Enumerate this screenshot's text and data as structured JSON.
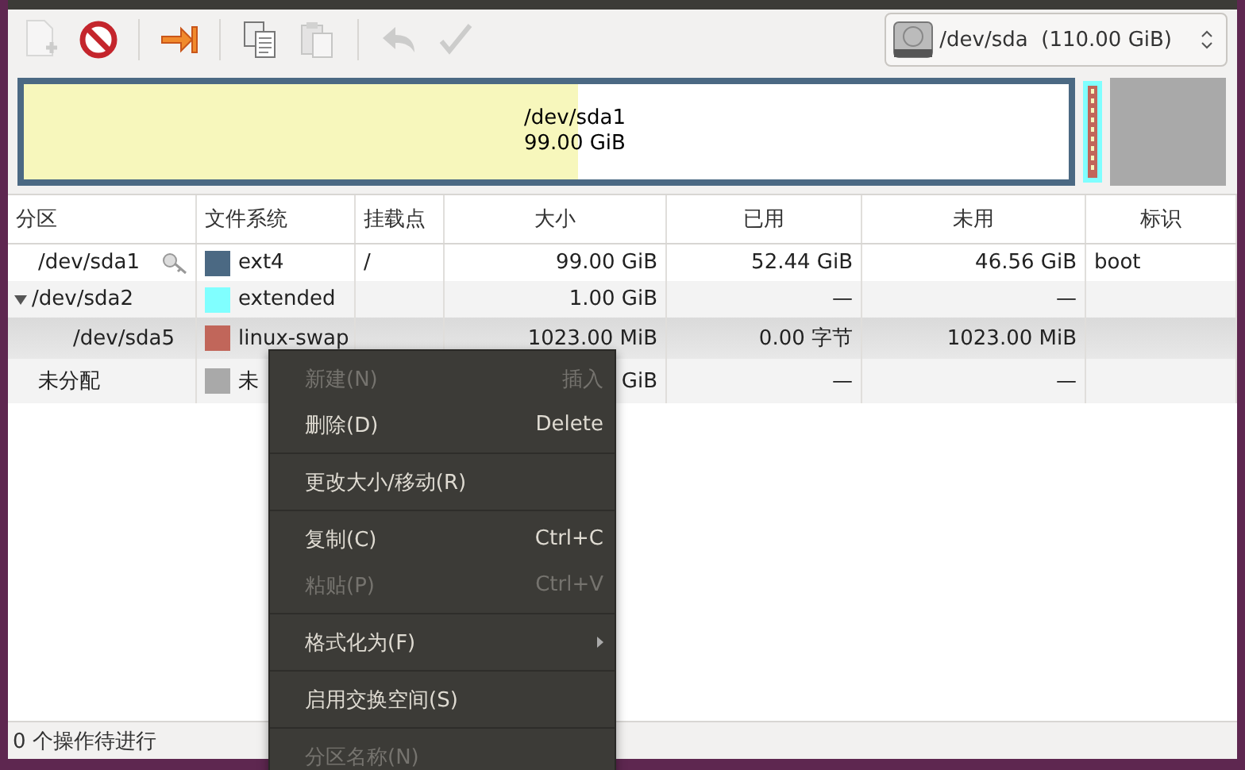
{
  "toolbar": [
    {
      "kind": "new",
      "disabled": true
    },
    {
      "kind": "delete",
      "disabled": false
    },
    {
      "kind": "sep"
    },
    {
      "kind": "resize",
      "disabled": false
    },
    {
      "kind": "sep"
    },
    {
      "kind": "copy",
      "disabled": false
    },
    {
      "kind": "paste",
      "disabled": true
    },
    {
      "kind": "sep"
    },
    {
      "kind": "undo",
      "disabled": true
    },
    {
      "kind": "apply",
      "disabled": true
    }
  ],
  "device": {
    "label": "/dev/sda",
    "size": "(110.00 GiB)"
  },
  "disk_map": {
    "primary": {
      "name": "/dev/sda1",
      "size": "99.00 GiB",
      "level": 0.53
    },
    "extended": {
      "color": "#80ffff"
    },
    "logical": {
      "color": "#c1665a"
    },
    "unallocated": {
      "color": "#a9a9a9"
    }
  },
  "table": {
    "columns": [
      "分区",
      "文件系统",
      "挂载点",
      "大小",
      "已用",
      "未用",
      "标识"
    ],
    "rows": [
      {
        "partition": "/dev/sda1",
        "locked": true,
        "color": "#4b6983",
        "filesystem": "ext4",
        "mount": "/",
        "size": "99.00 GiB",
        "used": "52.44 GiB",
        "unused": "46.56 GiB",
        "flags": "boot",
        "selected": false
      },
      {
        "partition": "/dev/sda2",
        "locked": false,
        "color": "#80ffff",
        "filesystem": "extended",
        "size": "1.00 GiB",
        "used": "—",
        "unused": "—",
        "selected": false,
        "expanded": true,
        "children": [
          {
            "partition": "/dev/sda5",
            "locked": false,
            "color": "#c1665a",
            "filesystem": "linux-swap",
            "size": "1023.00 MiB",
            "used": "0.00 字节",
            "unused": "1023.00 MiB",
            "selected": true
          }
        ]
      },
      {
        "partition": "未分配",
        "locked": false,
        "color": "#a9a9a9",
        "filesystem": "未",
        "size": "GiB",
        "used": "—",
        "unused": "—",
        "selected": false
      }
    ]
  },
  "status_bar": "0 个操作待进行",
  "context_menu": [
    {
      "kind": "item",
      "label": "新建(N)",
      "shortcut": "插入",
      "disabled": true
    },
    {
      "kind": "item",
      "label": "删除(D)",
      "shortcut": "Delete",
      "disabled": false
    },
    {
      "kind": "sep"
    },
    {
      "kind": "item",
      "label": "更改大小/移动(R)",
      "disabled": false
    },
    {
      "kind": "sep"
    },
    {
      "kind": "item",
      "label": "复制(C)",
      "shortcut": "Ctrl+C",
      "disabled": false
    },
    {
      "kind": "item",
      "label": "粘贴(P)",
      "shortcut": "Ctrl+V",
      "disabled": true
    },
    {
      "kind": "sep"
    },
    {
      "kind": "submenu",
      "label": "格式化为(F)",
      "disabled": false
    },
    {
      "kind": "sep"
    },
    {
      "kind": "item",
      "label": "启用交换空间(S)",
      "disabled": false
    },
    {
      "kind": "sep"
    },
    {
      "kind": "item",
      "label": "分区名称(N)",
      "disabled": true
    }
  ]
}
